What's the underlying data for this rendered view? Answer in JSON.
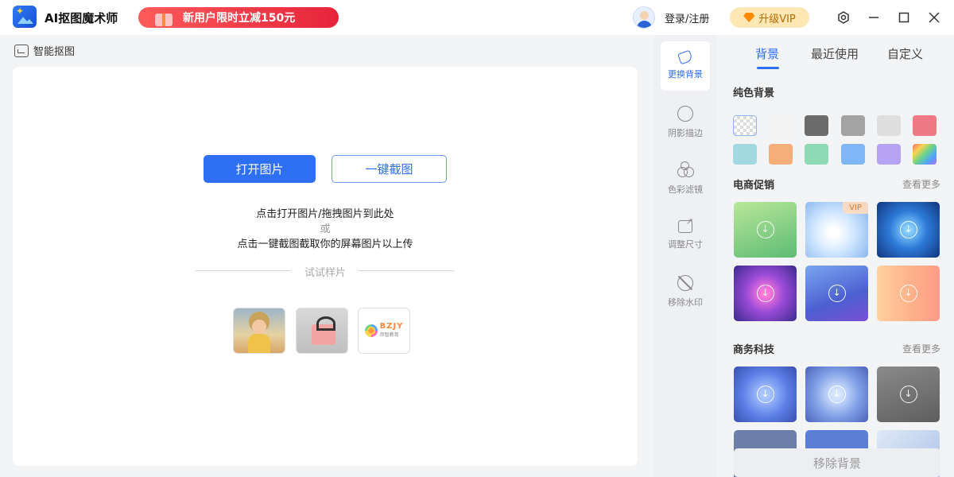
{
  "app": {
    "title": "AI抠图魔术师",
    "promo": "新用户限时立减150元"
  },
  "header": {
    "login": "登录/注册",
    "vip": "升级VIP"
  },
  "breadcrumb": {
    "label": "智能抠图"
  },
  "main": {
    "open_button": "打开图片",
    "screenshot_button": "一键截图",
    "hint_line1": "点击打开图片/拖拽图片到此处",
    "hint_or": "或",
    "hint_line2": "点击一键截图截取你的屏幕图片以上传",
    "sample_label": "试试样片",
    "sample_brand": "BZJY",
    "sample_brand_sub": "邦智教育"
  },
  "tools": [
    {
      "label": "更换背景",
      "icon": "paint-bucket-icon"
    },
    {
      "label": "阴影描边",
      "icon": "shadow-icon"
    },
    {
      "label": "色彩滤镜",
      "icon": "color-filter-icon"
    },
    {
      "label": "调整尺寸",
      "icon": "resize-icon"
    },
    {
      "label": "移除水印",
      "icon": "remove-watermark-icon"
    }
  ],
  "panel": {
    "tabs": [
      "背景",
      "最近使用",
      "自定义"
    ],
    "solid_title": "纯色背景",
    "ecommerce_title": "电商促销",
    "business_title": "商务科技",
    "more": "查看更多",
    "vip_tag": "VIP",
    "remove_button": "移除背景"
  },
  "swatch_colors": [
    "transparent",
    "#f4f4f4",
    "#6b6b6b",
    "#a3a3a3",
    "#dedede",
    "#ef7a85",
    "#a2d9e0",
    "#f6ad7a",
    "#8edab4",
    "#7eb6f7",
    "#b6a3f4",
    "rainbow"
  ]
}
